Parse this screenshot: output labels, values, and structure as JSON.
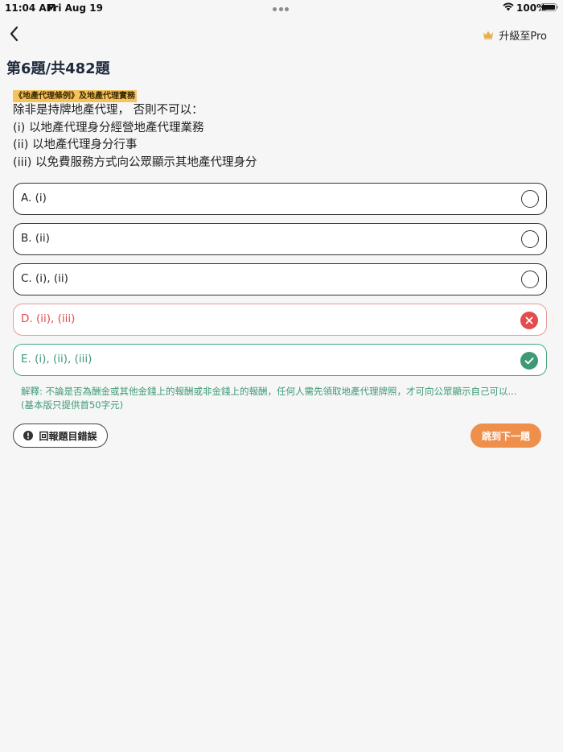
{
  "status_bar": {
    "time": "11:04 AM",
    "date": "Fri Aug 19",
    "battery": "100%",
    "icons": [
      "wifi-icon",
      "battery-icon"
    ]
  },
  "nav": {
    "back_icon": "chevron-left-icon",
    "upgrade_label": "升級至Pro",
    "upgrade_icon": "crown-icon"
  },
  "question": {
    "counter": "第6題/共482題",
    "category": "《地產代理條例》及地產代理實務",
    "lines": [
      "除非是持牌地產代理，  否則不可以：",
      "(i) 以地產代理身分經營地產代理業務",
      "(ii) 以地產代理身分行事",
      "(iii) 以免費服務方式向公眾顯示其地產代理身分"
    ]
  },
  "options": [
    {
      "label": "A. (i)",
      "state": "neutral"
    },
    {
      "label": "B. (ii)",
      "state": "neutral"
    },
    {
      "label": "C. (i), (ii)",
      "state": "neutral"
    },
    {
      "label": "D. (ii), (iii)",
      "state": "wrong"
    },
    {
      "label": "E. (i), (ii), (iii)",
      "state": "correct"
    }
  ],
  "explanation": {
    "line1": "解釋: 不論是否為酬金或其他金錢上的報酬或非金錢上的報酬，任何人需先領取地產代理牌照，才可向公眾顯示自己可以...",
    "line2": "(基本版只提供首50字元)"
  },
  "actions": {
    "report_label": "回報題目錯誤",
    "next_label": "跳到下一題"
  },
  "colors": {
    "wrong": "#e24c4c",
    "correct": "#3d9a74",
    "accent": "#ee8f4c",
    "tag": "#f5c25c"
  }
}
